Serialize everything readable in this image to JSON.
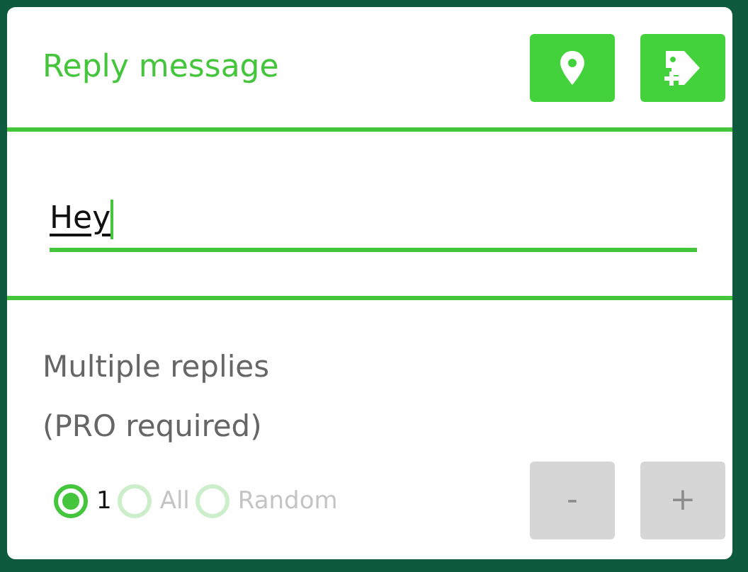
{
  "title": "Reply message",
  "header_buttons": [
    {
      "kind": "location"
    },
    {
      "kind": "tag_add"
    }
  ],
  "message": {
    "value": "Hey"
  },
  "multiple": {
    "title": "Multiple replies",
    "note": "(PRO required)",
    "options": [
      {
        "label": "1",
        "selected": true,
        "disabled": false
      },
      {
        "label": "All",
        "selected": false,
        "disabled": true
      },
      {
        "label": "Random",
        "selected": false,
        "disabled": true
      }
    ],
    "buttons": [
      {
        "label": "-",
        "disabled": true
      },
      {
        "label": "+",
        "disabled": true
      }
    ]
  }
}
